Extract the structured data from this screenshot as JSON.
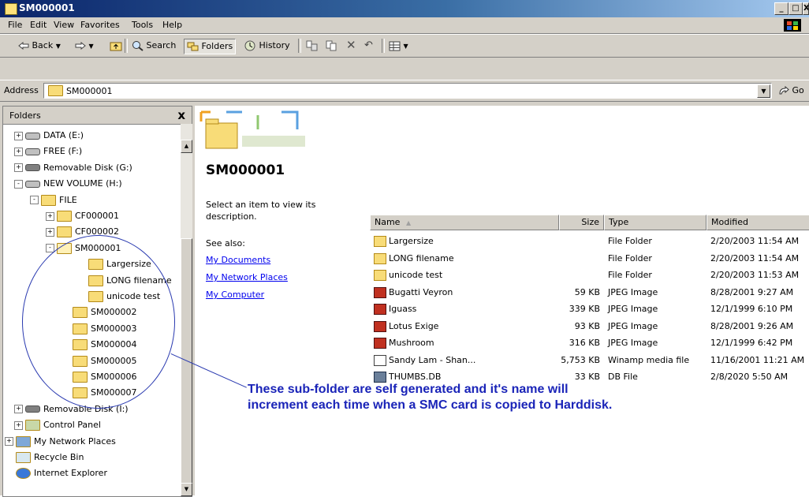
{
  "window": {
    "title": "SM000001",
    "minimize": "_",
    "maximize": "□",
    "close": "X"
  },
  "menu": [
    "File",
    "Edit",
    "View",
    "Favorites",
    "Tools",
    "Help"
  ],
  "toolbar": {
    "back": "Back",
    "search": "Search",
    "folders": "Folders",
    "history": "History"
  },
  "address": {
    "label": "Address",
    "value": "SM000001",
    "go": "Go"
  },
  "left_pane": {
    "title": "Folders",
    "close": "x",
    "tree": [
      {
        "label": "DATA (E:)",
        "kind": "drive",
        "expander": "+"
      },
      {
        "label": "FREE (F:)",
        "kind": "drive",
        "expander": "+"
      },
      {
        "label": "Removable Disk (G:)",
        "kind": "removable",
        "expander": "+"
      },
      {
        "label": "NEW VOLUME (H:)",
        "kind": "drive",
        "expander": "-"
      },
      {
        "label": "FILE",
        "kind": "folder",
        "expander": "-"
      },
      {
        "label": "CF000001",
        "kind": "folder",
        "expander": "+"
      },
      {
        "label": "CF000002",
        "kind": "folder",
        "expander": "+"
      },
      {
        "label": "SM000001",
        "kind": "folder-open",
        "expander": "-"
      },
      {
        "label": "Largersize",
        "kind": "folder",
        "expander": ""
      },
      {
        "label": "LONG filename",
        "kind": "folder",
        "expander": ""
      },
      {
        "label": "unicode test",
        "kind": "folder",
        "expander": ""
      },
      {
        "label": "SM000002",
        "kind": "folder",
        "expander": ""
      },
      {
        "label": "SM000003",
        "kind": "folder",
        "expander": ""
      },
      {
        "label": "SM000004",
        "kind": "folder",
        "expander": ""
      },
      {
        "label": "SM000005",
        "kind": "folder",
        "expander": ""
      },
      {
        "label": "SM000006",
        "kind": "folder",
        "expander": ""
      },
      {
        "label": "SM000007",
        "kind": "folder",
        "expander": ""
      },
      {
        "label": "Removable Disk (I:)",
        "kind": "removable",
        "expander": "+"
      },
      {
        "label": "Control Panel",
        "kind": "control-panel",
        "expander": "+"
      },
      {
        "label": "My Network Places",
        "kind": "network",
        "expander": "+"
      },
      {
        "label": "Recycle Bin",
        "kind": "recycle-bin",
        "expander": ""
      },
      {
        "label": "Internet Explorer",
        "kind": "ie",
        "expander": ""
      }
    ]
  },
  "info_panel": {
    "folder_title": "SM000001",
    "description": "Select an item to view its description.",
    "see_also": "See also:",
    "links": [
      "My Documents",
      "My Network Places",
      "My Computer"
    ]
  },
  "file_list": {
    "columns": [
      "Name",
      "Size",
      "Type",
      "Modified"
    ],
    "rows": [
      {
        "name": "Largersize",
        "size": "",
        "type": "File Folder",
        "modified": "2/20/2003 11:54 AM",
        "icon": "folder"
      },
      {
        "name": "LONG filename",
        "size": "",
        "type": "File Folder",
        "modified": "2/20/2003 11:54 AM",
        "icon": "folder"
      },
      {
        "name": "unicode test",
        "size": "",
        "type": "File Folder",
        "modified": "2/20/2003 11:53 AM",
        "icon": "folder"
      },
      {
        "name": "Bugatti Veyron",
        "size": "59 KB",
        "type": "JPEG Image",
        "modified": "8/28/2001 9:27 AM",
        "icon": "jpeg"
      },
      {
        "name": "Iguass",
        "size": "339 KB",
        "type": "JPEG Image",
        "modified": "12/1/1999 6:10 PM",
        "icon": "jpeg"
      },
      {
        "name": "Lotus Exige",
        "size": "93 KB",
        "type": "JPEG Image",
        "modified": "8/28/2001 9:26 AM",
        "icon": "jpeg"
      },
      {
        "name": "Mushroom",
        "size": "316 KB",
        "type": "JPEG Image",
        "modified": "12/1/1999 6:42 PM",
        "icon": "jpeg"
      },
      {
        "name": "Sandy Lam - Shan...",
        "size": "5,753 KB",
        "type": "Winamp media file",
        "modified": "11/16/2001 11:21 AM",
        "icon": "winamp"
      },
      {
        "name": "THUMBS.DB",
        "size": "33 KB",
        "type": "DB File",
        "modified": "2/8/2020 5:50 AM",
        "icon": "db"
      }
    ]
  },
  "annotation": "These sub-folder are self generated and it's name will increment each time when a SMC card is copied to Harddisk.",
  "colors": {
    "annotation": "#1a24b8",
    "titlebar_start": "#0a246a",
    "link": "#0000ee"
  }
}
